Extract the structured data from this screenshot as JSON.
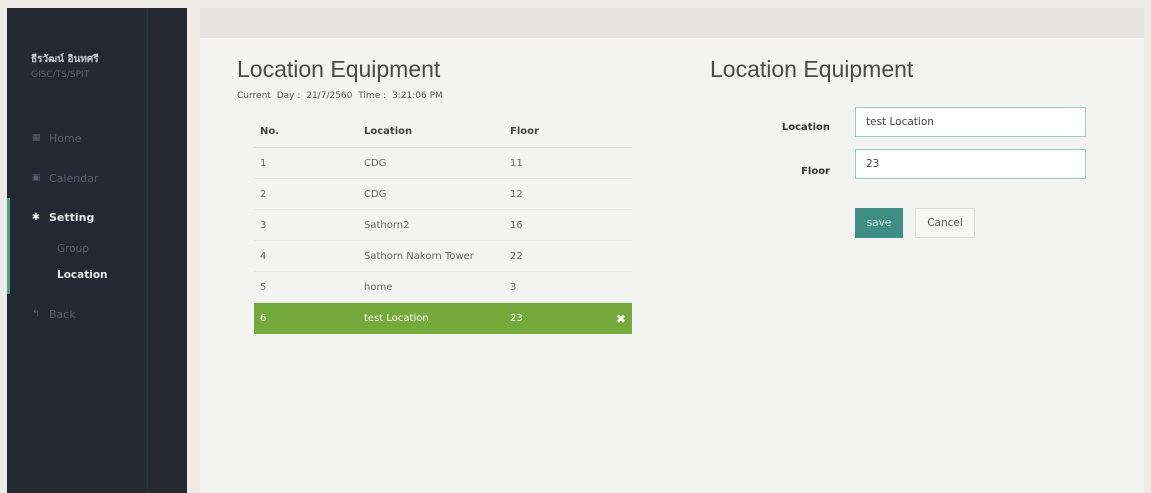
{
  "sidebar": {
    "user_name": "ธีรวัฒน์ อินทศรี",
    "user_org": "GISC/TS/SPIT",
    "home_label": "Home",
    "calendar_label": "Calendar",
    "setting_label": "Setting",
    "group_label": "Group",
    "location_label": "Location",
    "back_label": "Back"
  },
  "left_panel": {
    "title": "Location Equipment",
    "current_label": "Current",
    "day_label": "Day :",
    "day_value": "21/7/2560",
    "time_label": "Time :",
    "time_value": "3:21:06 PM",
    "columns": {
      "no": "No.",
      "location": "Location",
      "floor": "Floor"
    },
    "rows": [
      {
        "no": "1",
        "location": "CDG",
        "floor": "11"
      },
      {
        "no": "2",
        "location": "CDG",
        "floor": "12"
      },
      {
        "no": "3",
        "location": "Sathorn2",
        "floor": "16"
      },
      {
        "no": "4",
        "location": "Sathorn Nakorn Tower",
        "floor": "22"
      },
      {
        "no": "5",
        "location": "home",
        "floor": "3"
      },
      {
        "no": "6",
        "location": "test Location",
        "floor": "23",
        "delete_icon": "✖"
      }
    ]
  },
  "right_panel": {
    "title": "Location Equipment",
    "location_label": "Location",
    "location_value": "test Location",
    "floor_label": "Floor",
    "floor_value": "23",
    "save_label": "save",
    "cancel_label": "Cancel"
  },
  "colors": {
    "sidebar_bg": "#232833",
    "accent_green": "#4aa37c",
    "selected_row": "#74a93b",
    "save_button": "#3f8e86"
  },
  "icons": {
    "home": "grid-icon",
    "calendar": "calendar-icon",
    "setting": "gear-icon",
    "back": "back-arrow-icon",
    "delete": "close-icon"
  }
}
